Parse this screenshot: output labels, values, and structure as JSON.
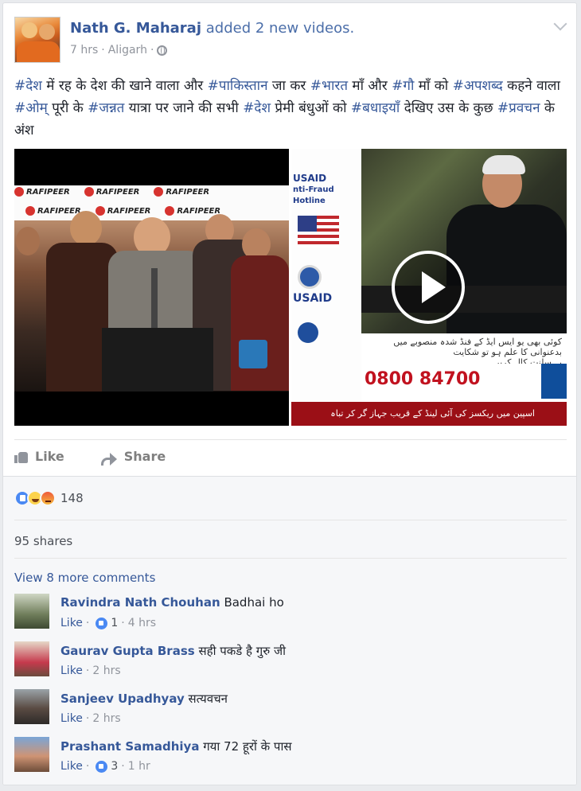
{
  "post": {
    "author": "Nath G. Maharaj",
    "action": "added 2 new videos.",
    "time": "7 hrs",
    "location": "Aligarh",
    "dot": "·",
    "text_segments": [
      {
        "text": "#देश",
        "tag": true
      },
      {
        "text": " में रह के देश की खाने वाला और ",
        "tag": false
      },
      {
        "text": "#पाकिस्तान",
        "tag": true
      },
      {
        "text": " जा कर ",
        "tag": false
      },
      {
        "text": "#भारत",
        "tag": true
      },
      {
        "text": " माँ और ",
        "tag": false
      },
      {
        "text": "#गौ",
        "tag": true
      },
      {
        "text": " माँ को ",
        "tag": false
      },
      {
        "text": "#अपशब्द",
        "tag": true
      },
      {
        "text": " कहने वाला ",
        "tag": false
      },
      {
        "text": "#ओम्",
        "tag": true
      },
      {
        "text": " पूरी के ",
        "tag": false
      },
      {
        "text": "#जन्नत",
        "tag": true
      },
      {
        "text": " यात्रा पर जाने की सभी ",
        "tag": false
      },
      {
        "text": "#देश",
        "tag": true
      },
      {
        "text": " प्रेमी बंधुओं को ",
        "tag": false
      },
      {
        "text": "#बधाइयाँ",
        "tag": true
      },
      {
        "text": " देखिए उस के कुछ ",
        "tag": false
      },
      {
        "text": "#प्रवचन",
        "tag": true
      },
      {
        "text": " के अंश",
        "tag": false
      }
    ]
  },
  "video1": {
    "logo_text": "RAFIPEER"
  },
  "video2": {
    "side_lines": [
      "USAID",
      "nti-Fraud",
      "Hotline"
    ],
    "usaid_label": "USAID",
    "urdu_text": "کوئی بھی یو ایس ایڈ کے فنڈ شدہ منصوبے میں بدعنوانی کا علم ہو تو شکایت",
    "urdu_text2": "بے سلنت کال کریں۔",
    "phone": "0800 84700",
    "ticker_urdu": "اسپین میں ریکسز کی آئی لینڈ کے قریب جہاز گر کر تباہ"
  },
  "actions": {
    "like": "Like",
    "share": "Share"
  },
  "reactions": {
    "count": "148"
  },
  "shares": "95 shares",
  "view_more": "View 8 more comments",
  "comments": [
    {
      "name": "Ravindra Nath Chouhan",
      "text": "Badhai ho",
      "like": "Like",
      "likes": "1",
      "time": "4 hrs"
    },
    {
      "name": "Gaurav Gupta Brass",
      "text": "सही पकडे है गुरु जी",
      "like": "Like",
      "likes": "",
      "time": "2 hrs"
    },
    {
      "name": "Sanjeev Upadhyay",
      "text": "सत्यवचन",
      "like": "Like",
      "likes": "",
      "time": "2 hrs"
    },
    {
      "name": "Prashant Samadhiya",
      "text": "गया 72 हूरों के पास",
      "like": "Like",
      "likes": "3",
      "time": "1 hr"
    }
  ]
}
